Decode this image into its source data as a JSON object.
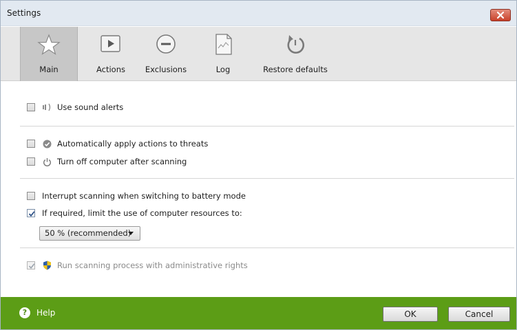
{
  "window": {
    "title": "Settings"
  },
  "toolbar": {
    "items": [
      {
        "label": "Main",
        "icon": "star-icon",
        "active": true
      },
      {
        "label": "Actions",
        "icon": "play-icon",
        "active": false
      },
      {
        "label": "Exclusions",
        "icon": "minus-circle-icon",
        "active": false
      },
      {
        "label": "Log",
        "icon": "log-document-icon",
        "active": false
      },
      {
        "label": "Restore defaults",
        "icon": "restore-icon",
        "active": false
      }
    ]
  },
  "settings": {
    "sound_alerts": {
      "label": "Use sound alerts",
      "checked": false,
      "icon": "speaker-icon"
    },
    "auto_apply": {
      "label": "Automatically apply actions to threats",
      "checked": false,
      "icon": "check-circle-icon"
    },
    "turn_off": {
      "label": "Turn off computer after scanning",
      "checked": false,
      "icon": "power-icon"
    },
    "battery": {
      "label": "Interrupt scanning when switching to battery mode",
      "checked": false
    },
    "limit": {
      "label": "If required, limit the use of computer resources to:",
      "checked": true
    },
    "limit_value": {
      "selected": "50 % (recommended)"
    },
    "admin": {
      "label": "Run scanning process with administrative rights",
      "checked": true,
      "disabled": true,
      "icon": "uac-shield-icon"
    }
  },
  "footer": {
    "help_label": "Help",
    "ok_label": "OK",
    "cancel_label": "Cancel"
  },
  "colors": {
    "footer_bg": "#5c9d16",
    "close_button": "#c9412a",
    "active_tab": "#c7c7c7"
  }
}
